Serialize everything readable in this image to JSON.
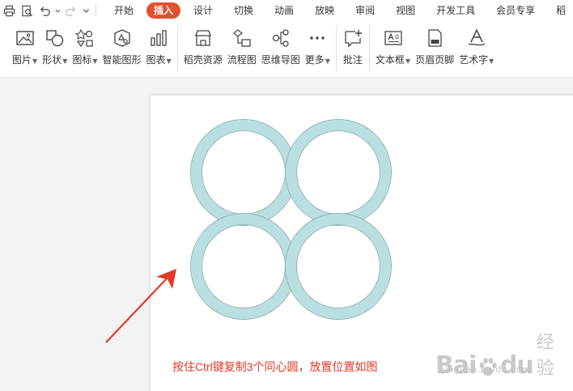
{
  "menu": {
    "tabs": [
      "开始",
      "插入",
      "设计",
      "切换",
      "动画",
      "放映",
      "审阅",
      "视图",
      "开发工具",
      "会员专享",
      "稻"
    ],
    "active_tab": "插入"
  },
  "ribbon": {
    "groups": [
      [
        {
          "label": "图片",
          "dropdown": true,
          "icon": "picture-icon"
        },
        {
          "label": "形状",
          "dropdown": true,
          "icon": "shapes-icon"
        },
        {
          "label": "图标",
          "dropdown": true,
          "icon": "icons-icon"
        },
        {
          "label": "智能图形",
          "dropdown": false,
          "icon": "smartart-icon"
        },
        {
          "label": "图表",
          "dropdown": true,
          "icon": "chart-icon"
        }
      ],
      [
        {
          "label": "稻壳资源",
          "dropdown": false,
          "icon": "store-icon"
        },
        {
          "label": "流程图",
          "dropdown": false,
          "icon": "flowchart-icon"
        },
        {
          "label": "思维导图",
          "dropdown": false,
          "icon": "mindmap-icon"
        },
        {
          "label": "更多",
          "dropdown": true,
          "icon": "more-icon"
        }
      ],
      [
        {
          "label": "批注",
          "dropdown": false,
          "icon": "comment-icon"
        }
      ],
      [
        {
          "label": "文本框",
          "dropdown": true,
          "icon": "textbox-icon"
        },
        {
          "label": "页眉页脚",
          "dropdown": false,
          "icon": "header-footer-icon"
        },
        {
          "label": "艺术字",
          "dropdown": true,
          "icon": "wordart-icon"
        }
      ]
    ]
  },
  "slide": {
    "caption": "按住Ctrl键复制3个同心圆，放置位置如图",
    "ring_color": "#b9dfe1",
    "ring_outline": "#8fb2b4",
    "arrow_color": "#e23a28"
  },
  "watermark": {
    "brand_left": "Bai",
    "brand_right": "du",
    "suffix": "经验",
    "url": "jingyan.baidu.com"
  }
}
